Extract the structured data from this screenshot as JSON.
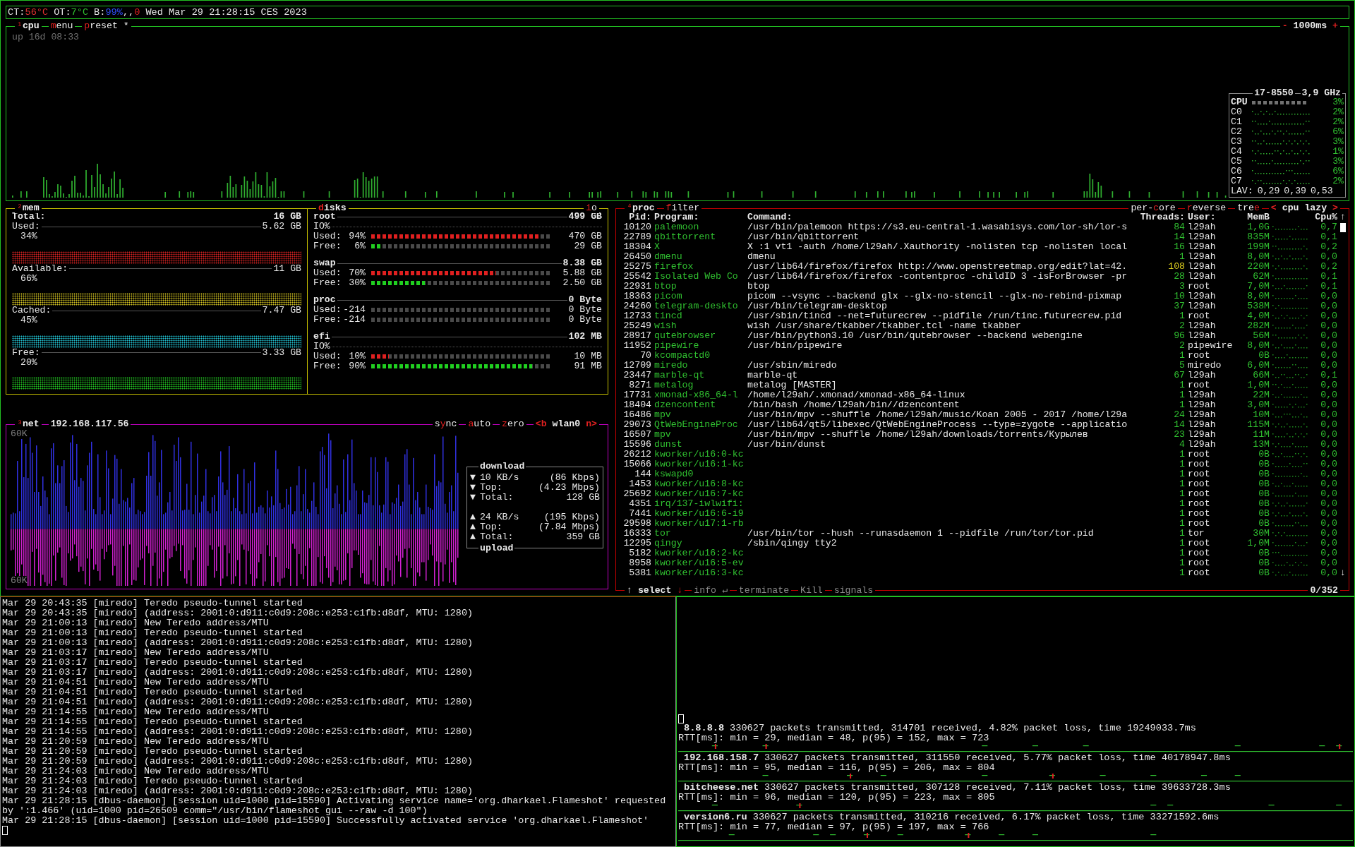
{
  "top_bar": {
    "sensors": [
      {
        "label": "CT:",
        "value": "56°C",
        "warning": true
      },
      {
        "label": "OT:",
        "value": "7°C",
        "warning": false
      }
    ],
    "battery": {
      "label": "B:",
      "value": "99%",
      "sep": ",,",
      "state": "0"
    },
    "clock": "Wed Mar 29 21:28:15 CES 2023"
  },
  "cpu": {
    "title": {
      "number": "¹",
      "label": "cpu"
    },
    "tabs": [
      {
        "key": "m",
        "rest": "enu"
      },
      {
        "key": "p",
        "rest": "reset *"
      }
    ],
    "interval": {
      "prev": "-",
      "label": "1000ms",
      "next": "+"
    },
    "uptime": "up 16d 08:33",
    "panel": {
      "model": "i7-8550",
      "freq": "3,9 GHz",
      "rows": [
        {
          "kind": "total",
          "label": "CPU",
          "pct": "3%"
        },
        {
          "kind": "core",
          "label": "C0",
          "pct": "2%"
        },
        {
          "kind": "core",
          "label": "C1",
          "pct": "2%"
        },
        {
          "kind": "core",
          "label": "C2",
          "pct": "6%"
        },
        {
          "kind": "core",
          "label": "C3",
          "pct": "3%"
        },
        {
          "kind": "core",
          "label": "C4",
          "pct": "1%"
        },
        {
          "kind": "core",
          "label": "C5",
          "pct": "3%"
        },
        {
          "kind": "core",
          "label": "C6",
          "pct": "6%"
        },
        {
          "kind": "core",
          "label": "C7",
          "pct": "2%"
        }
      ],
      "lav_label": "LAV:",
      "lav": [
        "0,29",
        "0,39",
        "0,53"
      ]
    }
  },
  "mem": {
    "title": {
      "number": "²",
      "label": "mem"
    },
    "total": {
      "label": "Total:",
      "value": "16 GB"
    },
    "items": [
      {
        "label": "Used:",
        "value": "5.62 GB",
        "pct": "34%",
        "color": "#d02020"
      },
      {
        "label": "Available:",
        "value": "11 GB",
        "pct": "66%",
        "color": "#d0c020"
      },
      {
        "label": "Cached:",
        "value": "7.47 GB",
        "pct": "45%",
        "color": "#20c0d0"
      },
      {
        "label": "Free:",
        "value": "3.33 GB",
        "pct": "20%",
        "color": "#20c020"
      }
    ]
  },
  "disks": {
    "tab": {
      "key": "d",
      "rest": "isks"
    },
    "right_tab": {
      "key": "i",
      "rest": "o"
    },
    "items": [
      {
        "name": "root",
        "total": "499 GB",
        "io": "IO%",
        "rows": [
          {
            "kind": "used",
            "label": "Used:",
            "pct": "94%",
            "level": 0.94,
            "value": "470 GB"
          },
          {
            "kind": "free",
            "label": "Free:",
            "pct": "6%",
            "level": 0.06,
            "value": "29 GB"
          }
        ]
      },
      {
        "name": "swap",
        "total": "8.38 GB",
        "rows": [
          {
            "kind": "used",
            "label": "Used:",
            "pct": "70%",
            "level": 0.7,
            "value": "5.88 GB"
          },
          {
            "kind": "free",
            "label": "Free:",
            "pct": "30%",
            "level": 0.3,
            "value": "2.50 GB"
          }
        ]
      },
      {
        "name": "proc",
        "total": "0 Byte",
        "rows": [
          {
            "kind": "used",
            "label": "Used:",
            "pct": "-214",
            "value": "0 Byte"
          },
          {
            "kind": "free",
            "label": "Free:",
            "pct": "-214",
            "value": "0 Byte"
          }
        ]
      },
      {
        "name": "efi",
        "total": "102 MB",
        "io": "IO%",
        "rows": [
          {
            "kind": "used",
            "label": "Used:",
            "pct": "10%",
            "level": 0.1,
            "value": "10 MB"
          },
          {
            "kind": "free",
            "label": "Free:",
            "pct": "90%",
            "level": 0.9,
            "value": "91 MB"
          }
        ]
      }
    ]
  },
  "net": {
    "title": {
      "number": "³",
      "label": "net"
    },
    "address": "192.168.117.56",
    "right_tabs": [
      {
        "prefix": "s",
        "key": "y",
        "rest": "nc"
      },
      {
        "key": "a",
        "rest": "uto"
      },
      {
        "key": "z",
        "rest": "ero"
      }
    ],
    "interface": {
      "prev": "<b",
      "label": "wlan0",
      "next": "n>"
    },
    "scale_top": "60K",
    "scale_bottom": "60K",
    "stats": {
      "title_top": "download",
      "title_bottom": "upload",
      "download_rows": [
        {
          "icon": "▼",
          "label": "10 KB/s",
          "value": "(86 Kbps)"
        },
        {
          "icon": "▼",
          "label": "Top:",
          "value": "(4.23 Mbps)"
        },
        {
          "icon": "▼",
          "label": "Total:",
          "value": "128 GB"
        }
      ],
      "upload_rows": [
        {
          "icon": "▲",
          "label": "24 KB/s",
          "value": "(195 Kbps)"
        },
        {
          "icon": "▲",
          "label": "Top:",
          "value": "(7.84 Mbps)"
        },
        {
          "icon": "▲",
          "label": "Total:",
          "value": "359 GB"
        }
      ]
    }
  },
  "proc": {
    "title": {
      "number": "⁴",
      "label": "proc"
    },
    "filter": {
      "key": "f",
      "rest": "ilter"
    },
    "right_tabs": [
      {
        "prefix": "per-",
        "key": "c",
        "rest": "ore"
      },
      {
        "key": "r",
        "rest": "everse"
      },
      {
        "prefix": "tre",
        "key": "e"
      }
    ],
    "sorting": {
      "prev": "<",
      "label": "cpu lazy",
      "next": ">"
    },
    "columns": [
      "Pid:",
      "Program:",
      "Command:",
      "Threads:",
      "User:",
      "MemB",
      "Cpu%"
    ],
    "scrollbar": {
      "up": "↑",
      "down": "↓"
    },
    "rows": [
      {
        "pid": "10120",
        "program": "palemoon",
        "command": "/usr/bin/palemoon https://s3.eu-central-1.wasabisys.com/lor-sh/lor-s",
        "threads": "84",
        "threads_high": false,
        "user": "l29ah",
        "mem": "1,0G",
        "cpu": "0,7"
      },
      {
        "pid": "22789",
        "program": "qbittorrent",
        "command": "/usr/bin/qbittorrent",
        "threads": "14",
        "threads_high": false,
        "user": "l29ah",
        "mem": "835M",
        "cpu": "0,1"
      },
      {
        "pid": "18304",
        "program": "X",
        "command": "X :1 vt1 -auth /home/l29ah/.Xauthority -nolisten tcp -nolisten local",
        "threads": "16",
        "threads_high": false,
        "user": "l29ah",
        "mem": "199M",
        "cpu": "0,2"
      },
      {
        "pid": "26450",
        "program": "dmenu",
        "command": "dmenu",
        "threads": "1",
        "threads_high": false,
        "user": "l29ah",
        "mem": "8,0M",
        "cpu": "0,0"
      },
      {
        "pid": "25275",
        "program": "firefox",
        "command": "/usr/lib64/firefox/firefox http://www.openstreetmap.org/edit?lat=42.",
        "threads": "108",
        "threads_high": true,
        "user": "l29ah",
        "mem": "220M",
        "cpu": "0,2"
      },
      {
        "pid": "25542",
        "program": "Isolated Web Co",
        "command": "/usr/lib64/firefox/firefox -contentproc -childID 3 -isForBrowser -pr",
        "threads": "28",
        "threads_high": false,
        "user": "l29ah",
        "mem": "62M",
        "cpu": "0,1"
      },
      {
        "pid": "22931",
        "program": "btop",
        "command": "btop",
        "threads": "3",
        "threads_high": false,
        "user": "root",
        "mem": "7,0M",
        "cpu": "0,1"
      },
      {
        "pid": "18363",
        "program": "picom",
        "command": "picom --vsync --backend glx --glx-no-stencil --glx-no-rebind-pixmap",
        "threads": "10",
        "threads_high": false,
        "user": "l29ah",
        "mem": "8,0M",
        "cpu": "0,0"
      },
      {
        "pid": "24260",
        "program": "telegram-deskto",
        "command": "/usr/bin/telegram-desktop",
        "threads": "37",
        "threads_high": false,
        "user": "l29ah",
        "mem": "538M",
        "cpu": "0,0"
      },
      {
        "pid": "12733",
        "program": "tincd",
        "command": "/usr/sbin/tincd --net=futurecrew --pidfile /run/tinc.futurecrew.pid",
        "threads": "1",
        "threads_high": false,
        "user": "root",
        "mem": "4,0M",
        "cpu": "0,0"
      },
      {
        "pid": "25249",
        "program": "wish",
        "command": "wish /usr/share/tkabber/tkabber.tcl -name tkabber",
        "threads": "2",
        "threads_high": false,
        "user": "l29ah",
        "mem": "282M",
        "cpu": "0,0"
      },
      {
        "pid": "28917",
        "program": "qutebrowser",
        "command": "/usr/bin/python3.10 /usr/bin/qutebrowser --backend webengine",
        "threads": "96",
        "threads_high": false,
        "user": "l29ah",
        "mem": "56M",
        "cpu": "0,0"
      },
      {
        "pid": "11952",
        "program": "pipewire",
        "command": "/usr/bin/pipewire",
        "threads": "2",
        "threads_high": false,
        "user": "pipewire",
        "mem": "8,0M",
        "cpu": "0,0"
      },
      {
        "pid": "70",
        "program": "kcompactd0",
        "threads": "1",
        "threads_high": false,
        "user": "root",
        "mem": "0B",
        "cpu": "0,0"
      },
      {
        "pid": "12709",
        "program": "miredo",
        "command": "/usr/sbin/miredo",
        "threads": "5",
        "threads_high": false,
        "user": "miredo",
        "mem": "6,0M",
        "cpu": "0,0"
      },
      {
        "pid": "23447",
        "program": "marble-qt",
        "command": "marble-qt",
        "threads": "67",
        "threads_high": false,
        "user": "l29ah",
        "mem": "66M",
        "cpu": "0,1"
      },
      {
        "pid": "8271",
        "program": "metalog",
        "command": "metalog [MASTER]",
        "threads": "1",
        "threads_high": false,
        "user": "root",
        "mem": "1,0M",
        "cpu": "0,0"
      },
      {
        "pid": "17731",
        "program": "xmonad-x86_64-l",
        "command": "/home/l29ah/.xmonad/xmonad-x86_64-linux",
        "threads": "1",
        "threads_high": false,
        "user": "l29ah",
        "mem": "22M",
        "cpu": "0,0"
      },
      {
        "pid": "18404",
        "program": "dzencontent",
        "command": "/bin/bash /home/l29ah/bin//dzencontent",
        "threads": "1",
        "threads_high": false,
        "user": "l29ah",
        "mem": "3,0M",
        "cpu": "0,0"
      },
      {
        "pid": "16486",
        "program": "mpv",
        "command": "/usr/bin/mpv --shuffle /home/l29ah/music/Koan 2005 - 2017 /home/l29a",
        "threads": "24",
        "threads_high": false,
        "user": "l29ah",
        "mem": "10M",
        "cpu": "0,0"
      },
      {
        "pid": "29073",
        "program": "QtWebEngineProc",
        "command": "/usr/lib64/qt5/libexec/QtWebEngineProcess --type=zygote --applicatio",
        "threads": "14",
        "threads_high": false,
        "user": "l29ah",
        "mem": "115M",
        "cpu": "0,0"
      },
      {
        "pid": "16507",
        "program": "mpv",
        "command": "/usr/bin/mpv --shuffle /home/l29ah/downloads/torrents/Курылев",
        "threads": "23",
        "threads_high": false,
        "user": "l29ah",
        "mem": "11M",
        "cpu": "0,0"
      },
      {
        "pid": "15596",
        "program": "dunst",
        "command": "/usr/bin/dunst",
        "threads": "4",
        "threads_high": false,
        "user": "l29ah",
        "mem": "13M",
        "cpu": "0,0"
      },
      {
        "pid": "26212",
        "program": "kworker/u16:0-kc",
        "threads": "1",
        "threads_high": false,
        "user": "root",
        "mem": "0B",
        "cpu": "0,0"
      },
      {
        "pid": "15066",
        "program": "kworker/u16:1-kc",
        "threads": "1",
        "threads_high": false,
        "user": "root",
        "mem": "0B",
        "cpu": "0,0"
      },
      {
        "pid": "144",
        "program": "kswapd0",
        "threads": "1",
        "threads_high": false,
        "user": "root",
        "mem": "0B",
        "cpu": "0,0"
      },
      {
        "pid": "1453",
        "program": "kworker/u16:8-kc",
        "threads": "1",
        "threads_high": false,
        "user": "root",
        "mem": "0B",
        "cpu": "0,0"
      },
      {
        "pid": "25692",
        "program": "kworker/u16:7-kc",
        "threads": "1",
        "threads_high": false,
        "user": "root",
        "mem": "0B",
        "cpu": "0,0"
      },
      {
        "pid": "4351",
        "program": "irq/137-iwlwifi:",
        "threads": "1",
        "threads_high": false,
        "user": "root",
        "mem": "0B",
        "cpu": "0,0"
      },
      {
        "pid": "7441",
        "program": "kworker/u16:6-i9",
        "threads": "1",
        "threads_high": false,
        "user": "root",
        "mem": "0B",
        "cpu": "0,0"
      },
      {
        "pid": "29598",
        "program": "kworker/u17:1-rb",
        "threads": "1",
        "threads_high": false,
        "user": "root",
        "mem": "0B",
        "cpu": "0,0"
      },
      {
        "pid": "16333",
        "program": "tor",
        "command": "/usr/bin/tor --hush --runasdaemon 1 --pidfile /run/tor/tor.pid",
        "threads": "1",
        "threads_high": false,
        "user": "tor",
        "mem": "30M",
        "cpu": "0,0"
      },
      {
        "pid": "12295",
        "program": "qingy",
        "command": "/sbin/qingy tty2",
        "threads": "1",
        "threads_high": false,
        "user": "root",
        "mem": "1,0M",
        "cpu": "0,0"
      },
      {
        "pid": "5182",
        "program": "kworker/u16:2-kc",
        "threads": "1",
        "threads_high": false,
        "user": "root",
        "mem": "0B",
        "cpu": "0,0"
      },
      {
        "pid": "8958",
        "program": "kworker/u16:5-ev",
        "threads": "1",
        "threads_high": false,
        "user": "root",
        "mem": "0B",
        "cpu": "0,0"
      },
      {
        "pid": "5381",
        "program": "kworker/u16:3-kc",
        "threads": "1",
        "threads_high": false,
        "user": "root",
        "mem": "0B",
        "cpu": "0,0"
      }
    ],
    "select": {
      "up": "↑",
      "label": "select",
      "down": "↓"
    },
    "actions": [
      {
        "label": "info ↵",
        "disabled": true
      },
      {
        "label": "terminate",
        "disabled": true
      },
      {
        "label": "Kill",
        "disabled": true
      },
      {
        "label": "signals",
        "disabled": true
      }
    ],
    "count": "0/352"
  },
  "log": [
    "Mar 29 20:43:35 [miredo] Teredo pseudo-tunnel started",
    "Mar 29 20:43:35 [miredo] (address: 2001:0:d911:c0d9:208c:e253:c1fb:d8df, MTU: 1280)",
    "Mar 29 21:00:13 [miredo] New Teredo address/MTU",
    "Mar 29 21:00:13 [miredo] Teredo pseudo-tunnel started",
    "Mar 29 21:00:13 [miredo] (address: 2001:0:d911:c0d9:208c:e253:c1fb:d8df, MTU: 1280)",
    "Mar 29 21:03:17 [miredo] New Teredo address/MTU",
    "Mar 29 21:03:17 [miredo] Teredo pseudo-tunnel started",
    "Mar 29 21:03:17 [miredo] (address: 2001:0:d911:c0d9:208c:e253:c1fb:d8df, MTU: 1280)",
    "Mar 29 21:04:51 [miredo] New Teredo address/MTU",
    "Mar 29 21:04:51 [miredo] Teredo pseudo-tunnel started",
    "Mar 29 21:04:51 [miredo] (address: 2001:0:d911:c0d9:208c:e253:c1fb:d8df, MTU: 1280)",
    "Mar 29 21:14:55 [miredo] New Teredo address/MTU",
    "Mar 29 21:14:55 [miredo] Teredo pseudo-tunnel started",
    "Mar 29 21:14:55 [miredo] (address: 2001:0:d911:c0d9:208c:e253:c1fb:d8df, MTU: 1280)",
    "Mar 29 21:20:59 [miredo] New Teredo address/MTU",
    "Mar 29 21:20:59 [miredo] Teredo pseudo-tunnel started",
    "Mar 29 21:20:59 [miredo] (address: 2001:0:d911:c0d9:208c:e253:c1fb:d8df, MTU: 1280)",
    "Mar 29 21:24:03 [miredo] New Teredo address/MTU",
    "Mar 29 21:24:03 [miredo] Teredo pseudo-tunnel started",
    "Mar 29 21:24:03 [miredo] (address: 2001:0:d911:c0d9:208c:e253:c1fb:d8df, MTU: 1280)",
    "Mar 29 21:28:15 [dbus-daemon] [session uid=1000 pid=15590] Activating service name='org.dharkael.Flameshot' requested by ':1.466' (uid=1000 pid=26509 comm=\"/usr/bin/flameshot gui --raw -d 100\")",
    "Mar 29 21:28:15 [dbus-daemon] [session uid=1000 pid=15590] Successfully activated service 'org.dharkael.Flameshot'"
  ],
  "ping": [
    {
      "host": "8.8.8.8",
      "summary": "330627 packets transmitted, 314701 received, 4.82% packet loss, time 19249033.7ms",
      "rtt": "RTT[ms]: min = 29, median = 48, p(95) = 152, max = 723"
    },
    {
      "host": "192.168.158.7",
      "summary": "330627 packets transmitted, 311550 received, 5.77% packet loss, time 40178947.8ms",
      "rtt": "RTT[ms]: min = 95, median = 116, p(95) = 206, max = 804"
    },
    {
      "host": "bitcheese.net",
      "summary": "330627 packets transmitted, 307128 received, 7.11% packet loss, time 39633728.3ms",
      "rtt": "RTT[ms]: min = 96, median = 120, p(95) = 223, max = 805"
    },
    {
      "host": "version6.ru",
      "summary": "330627 packets transmitted, 310216 received, 6.17% packet loss, time 33271592.6ms",
      "rtt": "RTT[ms]: min = 77, median = 97, p(95) = 197, max = 766"
    }
  ]
}
